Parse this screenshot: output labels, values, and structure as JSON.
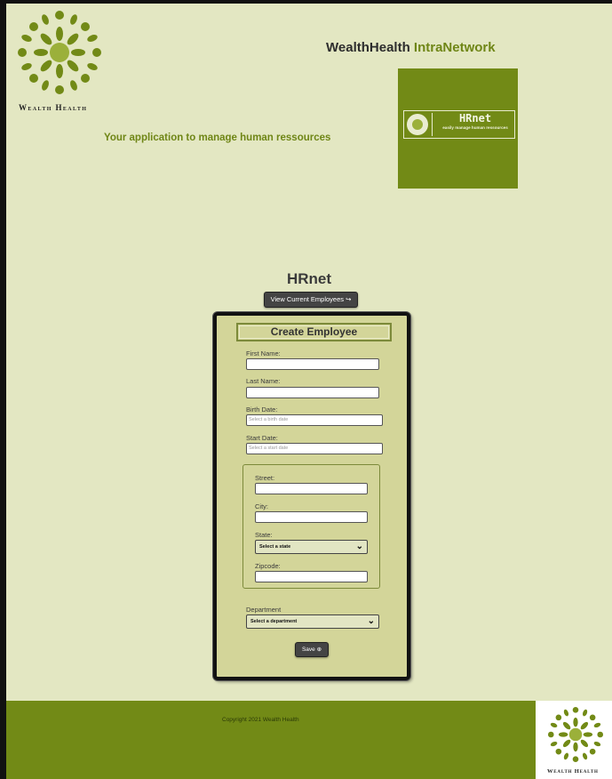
{
  "header": {
    "brand_text": "Wealth Health",
    "title_part1": "WealthHealth ",
    "title_part2": "IntraNetwork",
    "tagline": "Your application to manage human ressources",
    "hrnet_logo": {
      "word": "HRnet",
      "subtitle": "easily manage human ressources"
    },
    "icons": [
      "wealth-health-logo",
      "hrnet-logo"
    ]
  },
  "main": {
    "heading": "HRnet",
    "view_employees_button": "View Current Employees ↪",
    "form": {
      "title": "Create Employee",
      "first_name_label": "First Name:",
      "first_name_value": "",
      "last_name_label": "Last Name:",
      "last_name_value": "",
      "birth_date_label": "Birth Date:",
      "birth_date_placeholder": "Select a birth date",
      "start_date_label": "Start Date:",
      "start_date_placeholder": "Select a start date",
      "address": {
        "street_label": "Street:",
        "street_value": "",
        "city_label": "City:",
        "city_value": "",
        "state_label": "State:",
        "state_selected": "Select a state",
        "zipcode_label": "Zipcode:",
        "zipcode_value": ""
      },
      "department_label": "Department",
      "department_selected": "Select a department",
      "save_button": "Save ⊕"
    }
  },
  "footer": {
    "copyright": "Copyright 2021 Wealth Health",
    "brand_text": "Wealth Health"
  },
  "colors": {
    "page_background": "#e3e7c2",
    "brand_green": "#728a16",
    "accent_text": "#6f8616",
    "form_background": "#d3d599",
    "button_dark": "#444444"
  }
}
